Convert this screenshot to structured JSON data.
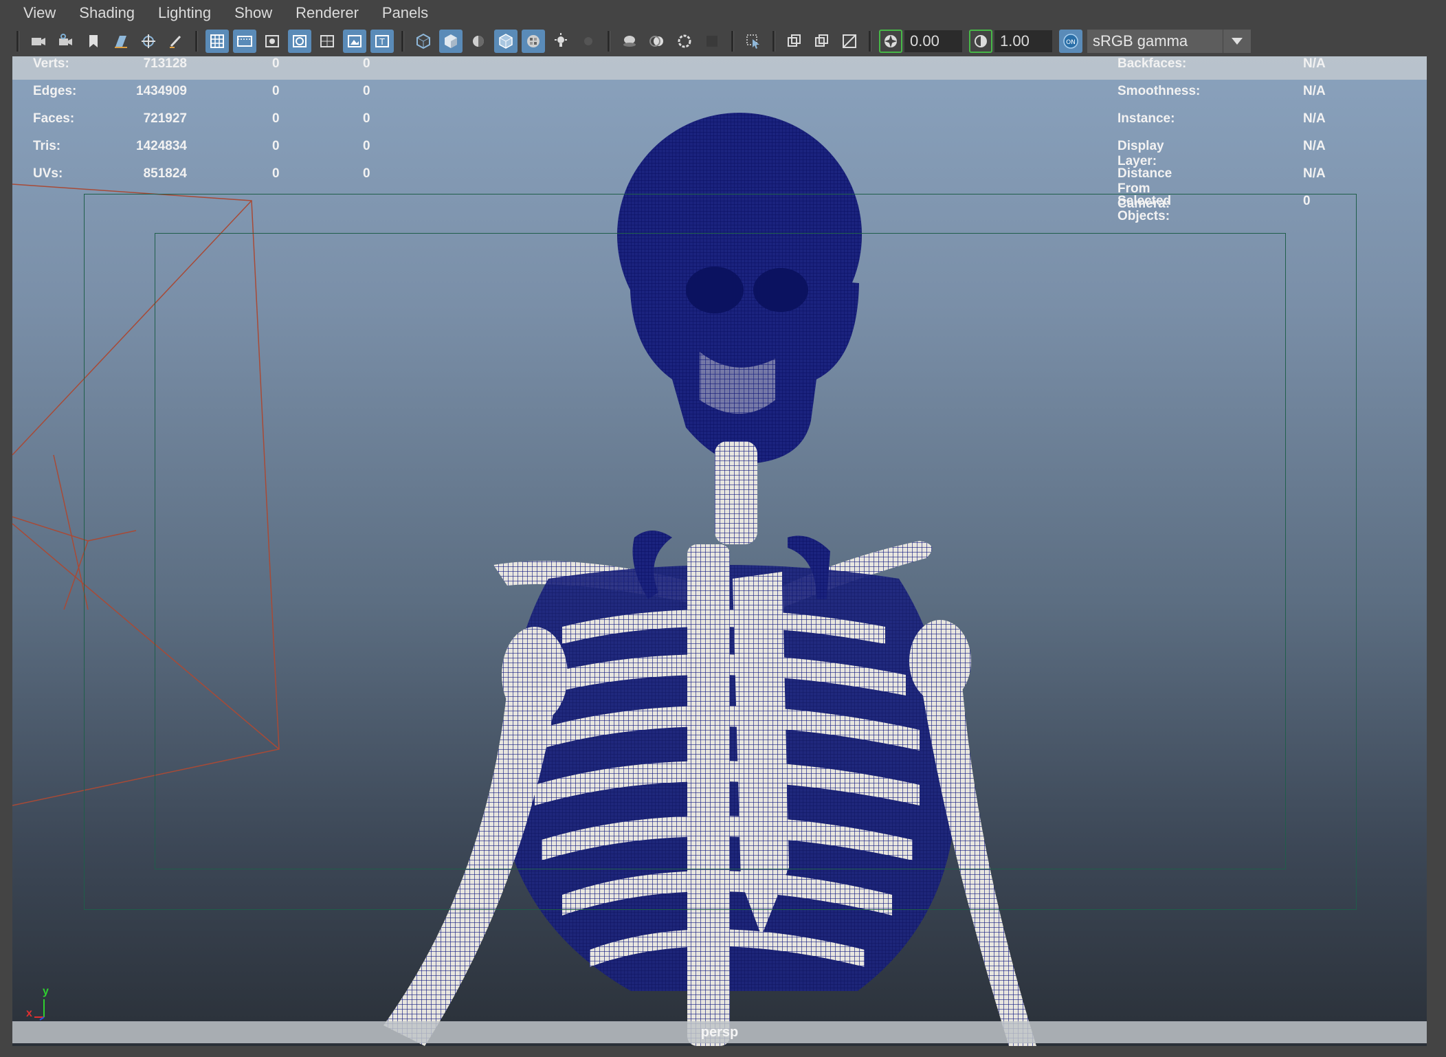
{
  "menubar": {
    "items": [
      "View",
      "Shading",
      "Lighting",
      "Show",
      "Renderer",
      "Panels"
    ]
  },
  "toolbar": {
    "exposure_value": "0.00",
    "gamma_value": "1.00",
    "color_management_badge": "ON",
    "view_transform": "sRGB gamma",
    "icons": [
      "camera-select-icon",
      "camera-attributes-icon",
      "bookmark-icon",
      "image-plane-icon",
      "2d-pan-zoom-icon",
      "grease-pencil-icon",
      "grid-icon",
      "film-gate-icon",
      "resolution-gate-icon",
      "gate-mask-icon",
      "field-chart-icon",
      "safe-action-icon",
      "safe-title-icon",
      "wireframe-icon",
      "smooth-shade-all-icon",
      "use-default-material-icon",
      "wireframe-on-shaded-icon",
      "xray-icon",
      "use-all-lights-icon",
      "shadows-icon",
      "screen-space-ambient-occlusion-icon",
      "motion-blur-icon",
      "anti-aliasing-icon",
      "depth-of-field-icon",
      "isolate-select-icon",
      "xray-active-components-icon",
      "xray-joints-icon",
      "texture-icon",
      "exposure-icon",
      "gamma-icon",
      "color-management-icon"
    ],
    "colors": {
      "active": "#5a8bb8",
      "background": "#444444"
    }
  },
  "hud_left": {
    "rows": [
      {
        "label": "Verts:",
        "value": "713128",
        "selected": "0",
        "uv": "0"
      },
      {
        "label": "Edges:",
        "value": "1434909",
        "selected": "0",
        "uv": "0"
      },
      {
        "label": "Faces:",
        "value": "721927",
        "selected": "0",
        "uv": "0"
      },
      {
        "label": "Tris:",
        "value": "1424834",
        "selected": "0",
        "uv": "0"
      },
      {
        "label": "UVs:",
        "value": "851824",
        "selected": "0",
        "uv": "0"
      }
    ]
  },
  "hud_right": {
    "rows": [
      {
        "label": "Backfaces:",
        "value": "N/A"
      },
      {
        "label": "Smoothness:",
        "value": "N/A"
      },
      {
        "label": "Instance:",
        "value": "N/A"
      },
      {
        "label": "Display Layer:",
        "value": "N/A"
      },
      {
        "label": "Distance From Camera:",
        "value": "N/A"
      },
      {
        "label": "Selected Objects:",
        "value": "0"
      }
    ]
  },
  "viewport": {
    "camera_name": "persp",
    "axis": {
      "y": "y",
      "x": "x"
    },
    "model": "wireframe-skeleton",
    "colors": {
      "wire": "#101a7a",
      "bone": "#e8e6df",
      "frame": "#1f5e4a",
      "camera": "#a84a36"
    }
  }
}
